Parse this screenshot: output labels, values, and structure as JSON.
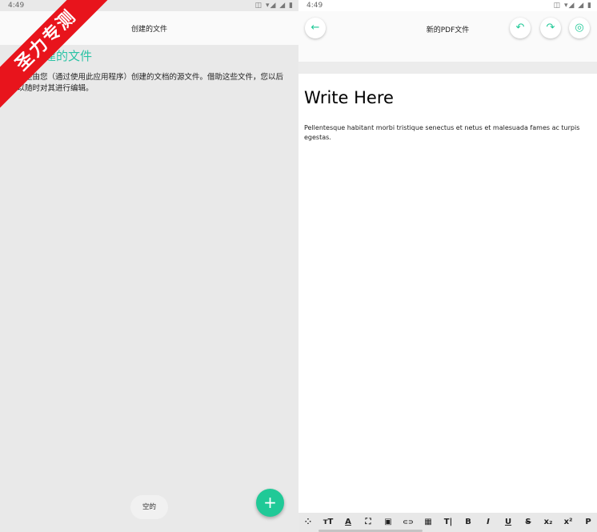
{
  "watermark": "圣力专测",
  "left_screen": {
    "status": {
      "time": "4:49",
      "icons": "◫ ▾◢ ◢ ▮"
    },
    "title": "创建的文件",
    "section_title": "创建的文件",
    "description": "这些是由您（通过使用此应用程序）创建的文档的源文件。借助这些文件，您以后可以随时对其进行编辑。",
    "empty_label": "空的",
    "fab_symbol": "+"
  },
  "right_screen": {
    "status": {
      "time": "4:49",
      "icons": "◫ ▾◢ ◢ ▮"
    },
    "title": "新的PDF文件",
    "back_symbol": "←",
    "undo_symbol": "↶",
    "redo_symbol": "↷",
    "preview_symbol": "◎",
    "doc_heading": "Write Here",
    "doc_body": "Pellentesque habitant morbi tristique senectus et netus et malesuada fames ac turpis egestas.",
    "toolbar": [
      "⁘",
      "ᴛT",
      "A",
      "⛶",
      "▣",
      "⊂⊃",
      "▦",
      "T|",
      "B",
      "I",
      "U",
      "S",
      "x₂",
      "x²",
      "P"
    ]
  },
  "colors": {
    "accent": "#20c997",
    "section_title": "#2bc3a5",
    "watermark": "#e8141c"
  }
}
